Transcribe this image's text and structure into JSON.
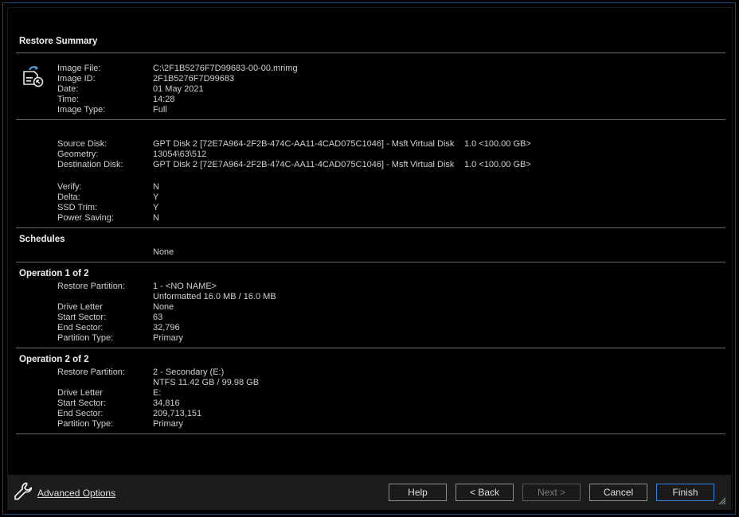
{
  "summary": {
    "title": "Restore Summary",
    "icon": "restore-image-icon",
    "image_rows": [
      {
        "label": "Image File:",
        "value": "C:\\2F1B5276F7D99683-00-00.mrimg"
      },
      {
        "label": "Image ID:",
        "value": "2F1B5276F7D99683"
      },
      {
        "label": "Date:",
        "value": "01 May 2021"
      },
      {
        "label": "Time:",
        "value": "14:28"
      },
      {
        "label": "Image Type:",
        "value": "Full"
      }
    ],
    "disk_rows": [
      {
        "label": "Source Disk:",
        "value": "GPT Disk 2 [72E7A964-2F2B-474C-AA11-4CAD075C1046] - Msft",
        "type": "Virtual Disk",
        "size": "1.0  <100.00 GB>"
      },
      {
        "label": "Geometry:",
        "value": "13054\\63\\512"
      },
      {
        "label": "Destination Disk:",
        "value": "GPT Disk 2 [72E7A964-2F2B-474C-AA11-4CAD075C1046] - Msft",
        "type": "Virtual Disk",
        "size": "1.0  <100.00 GB>"
      }
    ],
    "option_rows": [
      {
        "label": "Verify:",
        "value": "N"
      },
      {
        "label": "Delta:",
        "value": "Y"
      },
      {
        "label": "SSD Trim:",
        "value": "Y"
      },
      {
        "label": "Power Saving:",
        "value": "N"
      }
    ]
  },
  "schedules": {
    "title": "Schedules",
    "value": "None"
  },
  "operations": [
    {
      "title": "Operation 1 of 2",
      "restore_partition_label": "Restore Partition:",
      "restore_partition_value": "1 - <NO NAME>",
      "restore_partition_detail": "Unformatted 16.0 MB / 16.0 MB",
      "drive_letter_label": "Drive Letter",
      "drive_letter_value": "None",
      "start_sector_label": "Start Sector:",
      "start_sector_value": "63",
      "end_sector_label": "End Sector:",
      "end_sector_value": "32,796",
      "partition_type_label": "Partition Type:",
      "partition_type_value": "Primary"
    },
    {
      "title": "Operation 2 of 2",
      "restore_partition_label": "Restore Partition:",
      "restore_partition_value": "2 - Secondary (E:)",
      "restore_partition_detail": "NTFS 11.42 GB / 99.98 GB",
      "drive_letter_label": "Drive Letter",
      "drive_letter_value": "E:",
      "start_sector_label": "Start Sector:",
      "start_sector_value": "34,816",
      "end_sector_label": "End Sector:",
      "end_sector_value": "209,713,151",
      "partition_type_label": "Partition Type:",
      "partition_type_value": "Primary"
    }
  ],
  "footer": {
    "advanced_options_label": "Advanced Options",
    "help_label": "Help",
    "back_label": "< Back",
    "next_label": "Next >",
    "cancel_label": "Cancel",
    "finish_label": "Finish",
    "next_enabled": false
  },
  "colors": {
    "accent": "#2f86d9",
    "window_border": "#0d4f8a",
    "background": "#000000",
    "footer_background": "#1c1c1c"
  }
}
